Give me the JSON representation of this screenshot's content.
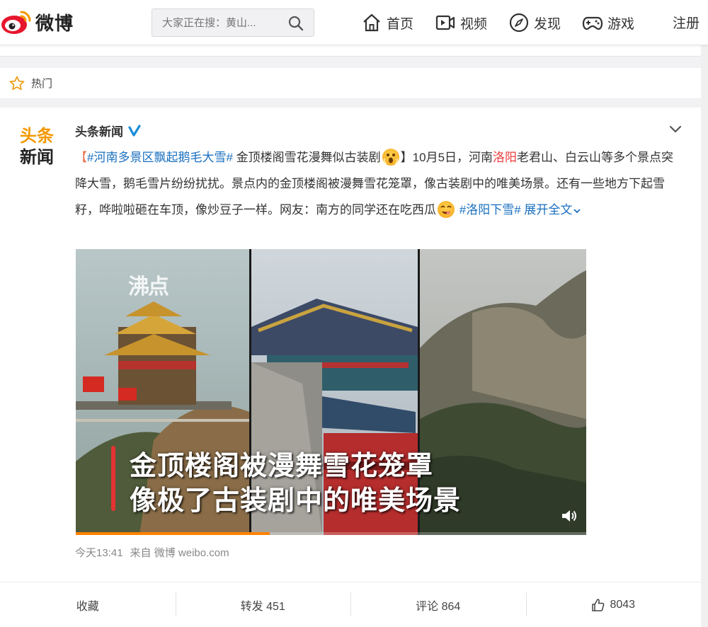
{
  "header": {
    "logo_text": "微博",
    "search_placeholder": "大家正在搜：黄山...",
    "nav": [
      {
        "label": "首页",
        "icon": "home-icon"
      },
      {
        "label": "视频",
        "icon": "video-icon"
      },
      {
        "label": "发现",
        "icon": "compass-icon"
      },
      {
        "label": "游戏",
        "icon": "gamepad-icon"
      }
    ],
    "register_label": "注册"
  },
  "hot_section": {
    "label": "热门",
    "icon": "star-icon"
  },
  "post": {
    "author": "头条新闻",
    "avatar_text_top": "头条",
    "avatar_text_bottom": "新闻",
    "verified": true,
    "text": {
      "bracket_open": "【",
      "hashtag1": "#河南多景区飘起鹅毛大雪#",
      "headline": " 金顶楼阁雪花漫舞似古装剧",
      "bracket_close": "】10月5日，河南",
      "place": "洛阳",
      "body1": "老君山、白云山等多个景点突降大雪，鹅毛雪片纷纷扰扰。景点内的金顶楼阁被漫舞雪花笼罩，像古装剧中的唯美场景。还有一些地方下起雪籽，哗啦啦砸在车顶，像炒豆子一样。网友：南方的同学还在吃西瓜",
      "hashtag2": "#洛阳下雪#",
      "expand": "展开全文"
    },
    "video": {
      "watermark": "沸点",
      "caption_line1": "金顶楼阁被漫舞雪花笼罩",
      "caption_line2": "像极了古装剧中的唯美场景",
      "progress_fraction": 0.38
    },
    "time": "今天13:41",
    "source_prefix": "来自",
    "source": "微博 weibo.com",
    "actions": {
      "favorite": "收藏",
      "repost": "转发 451",
      "comment": "评论 864",
      "like": "8043"
    }
  },
  "colors": {
    "accent_orange": "#ff8200",
    "link_blue": "#1a6fbf",
    "tag_orange": "#eb7350",
    "brand_red": "#e6162d"
  }
}
